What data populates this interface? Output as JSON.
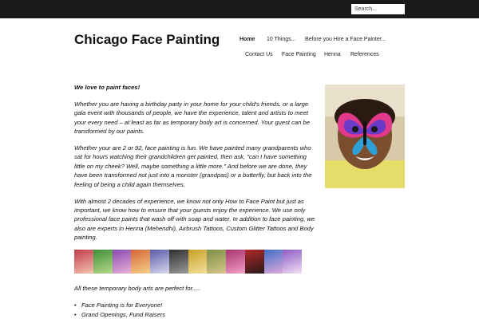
{
  "search": {
    "placeholder": "Search..."
  },
  "site": {
    "title": "Chicago Face Painting"
  },
  "nav": {
    "row1": [
      "Home",
      "10 Things...",
      "Before you Hire a Face Painter..."
    ],
    "row2": [
      "Contact Us",
      "Face Painting",
      "Henna",
      "References"
    ]
  },
  "content": {
    "lead": "We love to paint faces!",
    "p1": "Whether you are having a birthday party in your home for your child's friends, or a large gala event with thousands of people, we have the experience, talent and artists to meet your every need – at least as far as temporary body art is concerned.  Your guest can be transformed by our paints.",
    "p2": "Whether your are 2 or 92, face painting is fun.  We have painted many grandparents who sat for hours watching their grandchildren get painted, then ask, \"can I have something little on my cheek?  Well, maybe something a little more.\"  And before we are done, they have been transformed not just into a monster (grandpas) or a butterfly, but back into the feeling of being a child again themselves.",
    "p3": "With almost 2 decades of experience, we know not only How to Face Paint but just as important, we know how to ensure that your guests enjoy the experience.   We use only professional face paints that wash off with soap and water. In addition to face painting, we also are experts in Henna (Mehendhi), Airbrush Tattoos, Custom Glitter Tattoos and Body painting.",
    "intro": "All these temporary body arts are perfect for.....",
    "bullets": [
      "Face Painting is for Everyone!",
      "Grand Openings, Fund Raisers"
    ]
  },
  "colors": {
    "topbar": "#1a1a1a",
    "thumbs": [
      "#c23a4a",
      "#3f8f3a",
      "#8a4ab0",
      "#d6653a",
      "#5a5aa8",
      "#2f2f2f",
      "#c9a027",
      "#7d8f45",
      "#a8326f",
      "#b22828",
      "#3e6fc8",
      "#8d5bc4"
    ]
  }
}
